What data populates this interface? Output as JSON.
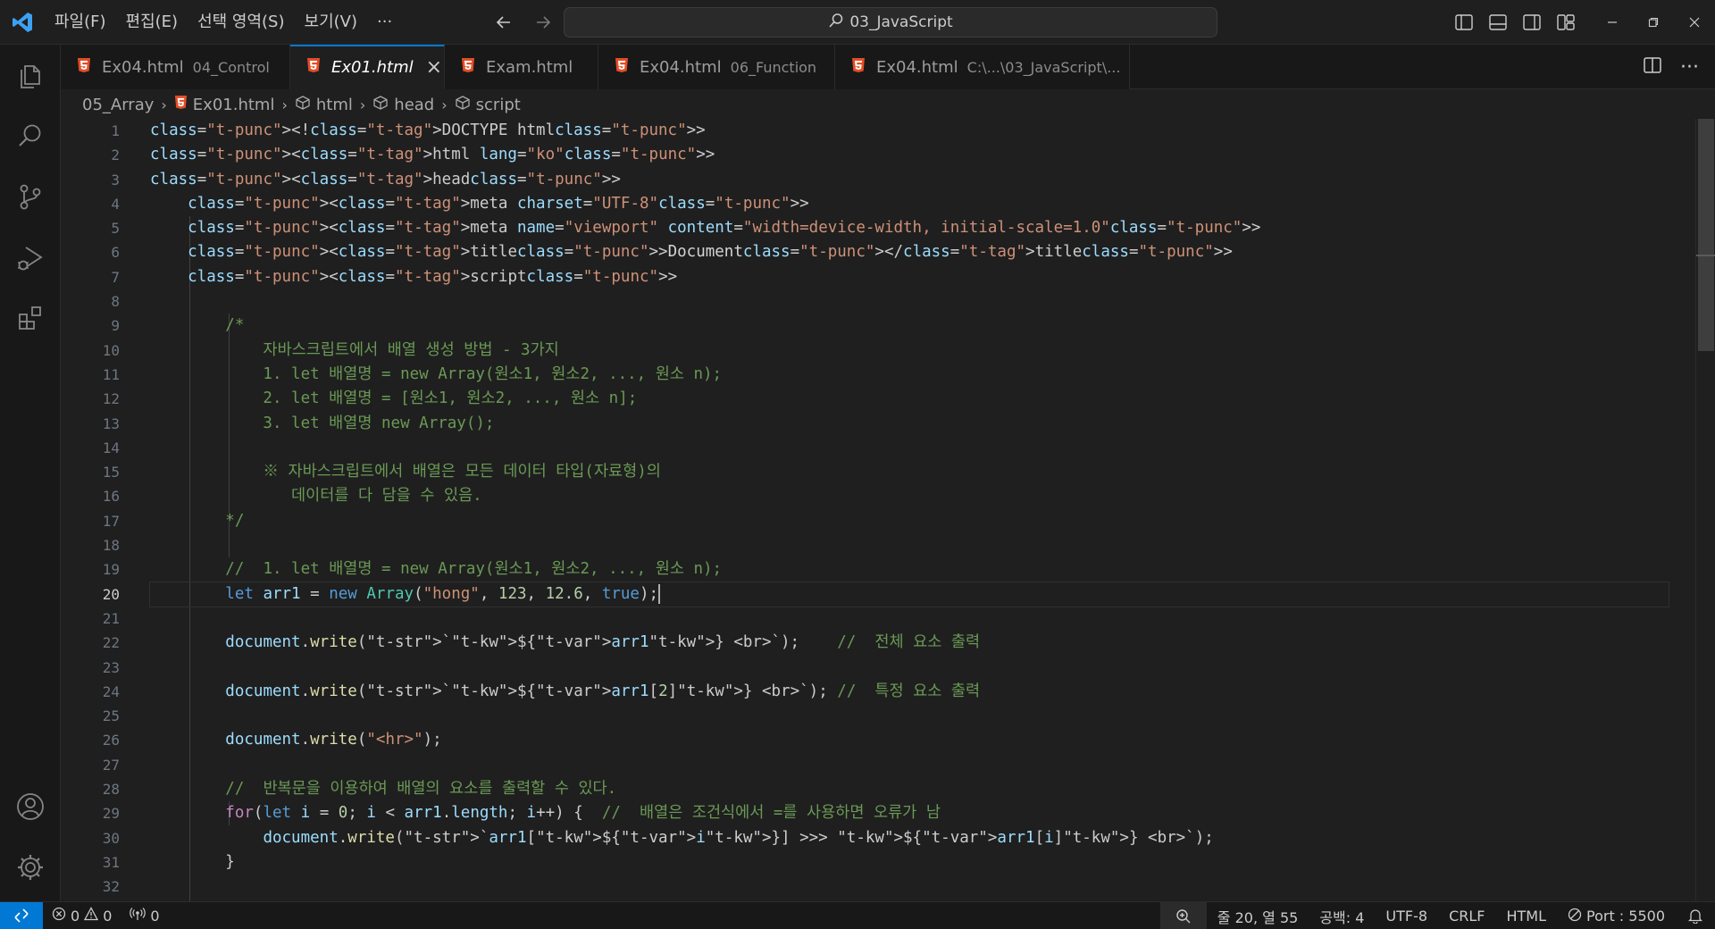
{
  "menu": [
    "파일(F)",
    "편집(E)",
    "선택 영역(S)",
    "보기(V)",
    "···"
  ],
  "search": {
    "text": "03_JavaScript"
  },
  "tabs": [
    {
      "name": "Ex04.html",
      "desc": "04_Control",
      "active": false
    },
    {
      "name": "Ex01.html",
      "desc": "",
      "active": true
    },
    {
      "name": "Exam.html",
      "desc": "",
      "active": false
    },
    {
      "name": "Ex04.html",
      "desc": "06_Function",
      "active": false
    },
    {
      "name": "Ex04.html",
      "desc": "C:\\...\\03_JavaScript\\...",
      "active": false
    }
  ],
  "breadcrumb": [
    "05_Array",
    "Ex01.html",
    "html",
    "head",
    "script"
  ],
  "editor": {
    "line_numbers": [
      "1",
      "2",
      "3",
      "4",
      "5",
      "6",
      "7",
      "8",
      "9",
      "10",
      "11",
      "12",
      "13",
      "14",
      "15",
      "16",
      "17",
      "18",
      "19",
      "20",
      "21",
      "22",
      "23",
      "24",
      "25",
      "26",
      "27",
      "28",
      "29",
      "30",
      "31",
      "32"
    ],
    "current_line": "20",
    "lines": [
      "<!DOCTYPE html>",
      "<html lang=\"ko\">",
      "<head>",
      "    <meta charset=\"UTF-8\">",
      "    <meta name=\"viewport\" content=\"width=device-width, initial-scale=1.0\">",
      "    <title>Document</title>",
      "    <script>",
      "",
      "        /*",
      "            자바스크립트에서 배열 생성 방법 - 3가지",
      "            1. let 배열명 = new Array(원소1, 원소2, ..., 원소 n);",
      "            2. let 배열명 = [원소1, 원소2, ..., 원소 n];",
      "            3. let 배열명 new Array();",
      "",
      "            ※ 자바스크립트에서 배열은 모든 데이터 타입(자료형)의",
      "               데이터를 다 담을 수 있음.",
      "        */",
      "",
      "        //  1. let 배열명 = new Array(원소1, 원소2, ..., 원소 n);",
      "        let arr1 = new Array(\"hong\", 123, 12.6, true);",
      "",
      "        document.write(`${arr1} <br>`);    //  전체 요소 출력",
      "",
      "        document.write(`${arr1[2]} <br>`); //  특정 요소 출력",
      "",
      "        document.write(\"<hr>\");",
      "",
      "        //  반복문을 이용하여 배열의 요소를 출력할 수 있다.",
      "        for(let i = 0; i < arr1.length; i++) {  //  배열은 조건식에서 =를 사용하면 오류가 남",
      "            document.write(`arr1[${i}] >>> ${arr1[i]} <br>`);",
      "        }",
      ""
    ]
  },
  "status": {
    "errors": "0",
    "warnings": "0",
    "ports": "0",
    "position": "줄 20, 열 55",
    "spaces": "공백: 4",
    "encoding": "UTF-8",
    "eol": "CRLF",
    "language": "HTML",
    "port": "Port : 5500"
  },
  "colors": {
    "accent": "#0078d4",
    "background": "#1f1f1f",
    "html_icon": "#e44d26"
  }
}
